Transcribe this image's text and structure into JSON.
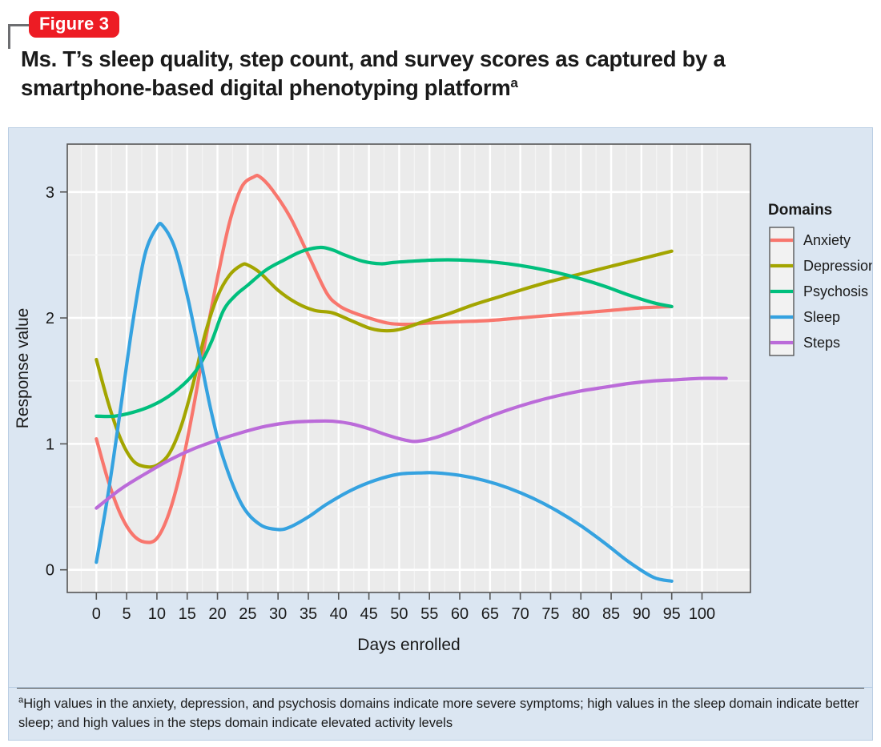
{
  "figure": {
    "badge_label": "Figure 3",
    "title_line1": "Ms. T’s sleep quality, step count, and survey scores as captured by a",
    "title_line2": "smartphone-based digital phenotyping platform",
    "title_superscript": "a",
    "footnote_marker": "a",
    "footnote_text": "High values in the anxiety, depression, and psychosis domains indicate more severe symptoms; high values in the sleep domain indicate better sleep; and high values in the steps domain indicate elevated activity levels"
  },
  "colors": {
    "badge_red": "#ed1c24",
    "panel_background": "#dbe6f2",
    "plot_background": "#ebebeb",
    "gridline_major": "#ffffff",
    "gridline_minor": "#f5f5f5",
    "anxiety": "#f8766d",
    "depression": "#a3a500",
    "psychosis": "#00bf7d",
    "sleep": "#35a2e0",
    "steps": "#bb6bd9"
  },
  "chart_data": {
    "type": "line",
    "title": "",
    "xlabel": "Days enrolled",
    "ylabel": "Response value",
    "xlim": [
      -4.8,
      108
    ],
    "ylim": [
      -0.18,
      3.38
    ],
    "xticks": [
      0,
      5,
      10,
      15,
      20,
      25,
      30,
      35,
      40,
      45,
      50,
      55,
      60,
      65,
      70,
      75,
      80,
      85,
      90,
      95,
      100
    ],
    "yticks": [
      0,
      1,
      2,
      3
    ],
    "ytick_labels": [
      "0",
      "1",
      "2",
      "3"
    ],
    "grid": true,
    "legend_title": "Domains",
    "legend_position": "right",
    "series": [
      {
        "name": "Anxiety",
        "color": "#f8766d",
        "x": [
          0,
          2,
          4,
          6,
          8,
          10,
          12,
          14,
          16,
          18,
          20,
          22,
          24,
          26,
          27,
          29,
          32,
          35,
          38,
          40,
          42,
          45,
          48,
          50,
          52,
          55,
          60,
          65,
          70,
          75,
          80,
          85,
          90,
          95
        ],
        "y": [
          1.04,
          0.7,
          0.44,
          0.28,
          0.22,
          0.25,
          0.45,
          0.8,
          1.28,
          1.82,
          2.32,
          2.76,
          3.04,
          3.12,
          3.12,
          3.02,
          2.8,
          2.5,
          2.2,
          2.1,
          2.05,
          2.0,
          1.96,
          1.95,
          1.95,
          1.96,
          1.97,
          1.98,
          2.0,
          2.02,
          2.04,
          2.06,
          2.08,
          2.09
        ]
      },
      {
        "name": "Depression",
        "color": "#a3a500",
        "x": [
          0,
          2,
          4,
          6,
          8,
          10,
          12,
          14,
          16,
          18,
          20,
          22,
          24,
          25,
          27,
          30,
          33,
          36,
          39,
          42,
          45,
          47,
          49,
          51,
          54,
          58,
          62,
          66,
          70,
          75,
          80,
          85,
          90,
          95
        ],
        "y": [
          1.67,
          1.32,
          1.04,
          0.87,
          0.82,
          0.83,
          0.92,
          1.14,
          1.48,
          1.88,
          2.17,
          2.34,
          2.42,
          2.42,
          2.36,
          2.22,
          2.12,
          2.06,
          2.04,
          1.98,
          1.92,
          1.9,
          1.9,
          1.92,
          1.97,
          2.03,
          2.1,
          2.16,
          2.22,
          2.29,
          2.35,
          2.41,
          2.47,
          2.53
        ]
      },
      {
        "name": "Psychosis",
        "color": "#00bf7d",
        "x": [
          0,
          3,
          6,
          9,
          12,
          15,
          17,
          19,
          21,
          23,
          25,
          28,
          31,
          34,
          37,
          39,
          41,
          44,
          47,
          49,
          52,
          56,
          60,
          64,
          68,
          72,
          76,
          80,
          84,
          88,
          92,
          95
        ],
        "y": [
          1.22,
          1.22,
          1.25,
          1.3,
          1.38,
          1.5,
          1.62,
          1.81,
          2.06,
          2.18,
          2.26,
          2.38,
          2.46,
          2.53,
          2.56,
          2.54,
          2.5,
          2.45,
          2.43,
          2.44,
          2.45,
          2.46,
          2.46,
          2.45,
          2.43,
          2.4,
          2.36,
          2.31,
          2.25,
          2.18,
          2.12,
          2.09
        ]
      },
      {
        "name": "Sleep",
        "color": "#35a2e0",
        "x": [
          0,
          2,
          4,
          6,
          8,
          10,
          11,
          13,
          15,
          17,
          19,
          21,
          24,
          27,
          30,
          32,
          35,
          38,
          42,
          46,
          50,
          54,
          56,
          60,
          64,
          68,
          72,
          76,
          80,
          84,
          88,
          92,
          95
        ],
        "y": [
          0.06,
          0.62,
          1.28,
          1.96,
          2.5,
          2.72,
          2.73,
          2.55,
          2.18,
          1.72,
          1.25,
          0.88,
          0.52,
          0.36,
          0.32,
          0.34,
          0.42,
          0.52,
          0.63,
          0.71,
          0.76,
          0.77,
          0.77,
          0.75,
          0.71,
          0.65,
          0.57,
          0.47,
          0.35,
          0.21,
          0.06,
          -0.06,
          -0.09
        ]
      },
      {
        "name": "Steps",
        "color": "#bb6bd9",
        "x": [
          0,
          4,
          8,
          12,
          16,
          20,
          24,
          28,
          32,
          36,
          39,
          42,
          45,
          48,
          51,
          53,
          56,
          60,
          64,
          68,
          72,
          76,
          80,
          84,
          88,
          92,
          96,
          100,
          104
        ],
        "y": [
          0.49,
          0.64,
          0.76,
          0.87,
          0.96,
          1.03,
          1.09,
          1.14,
          1.17,
          1.18,
          1.18,
          1.16,
          1.12,
          1.07,
          1.03,
          1.02,
          1.05,
          1.12,
          1.2,
          1.27,
          1.33,
          1.38,
          1.42,
          1.45,
          1.48,
          1.5,
          1.51,
          1.52,
          1.52
        ]
      }
    ]
  },
  "legend": {
    "title": "Domains",
    "items": [
      {
        "label": "Anxiety",
        "color": "#f8766d"
      },
      {
        "label": "Depression",
        "color": "#a3a500"
      },
      {
        "label": "Psychosis",
        "color": "#00bf7d"
      },
      {
        "label": "Sleep",
        "color": "#35a2e0"
      },
      {
        "label": "Steps",
        "color": "#bb6bd9"
      }
    ]
  }
}
